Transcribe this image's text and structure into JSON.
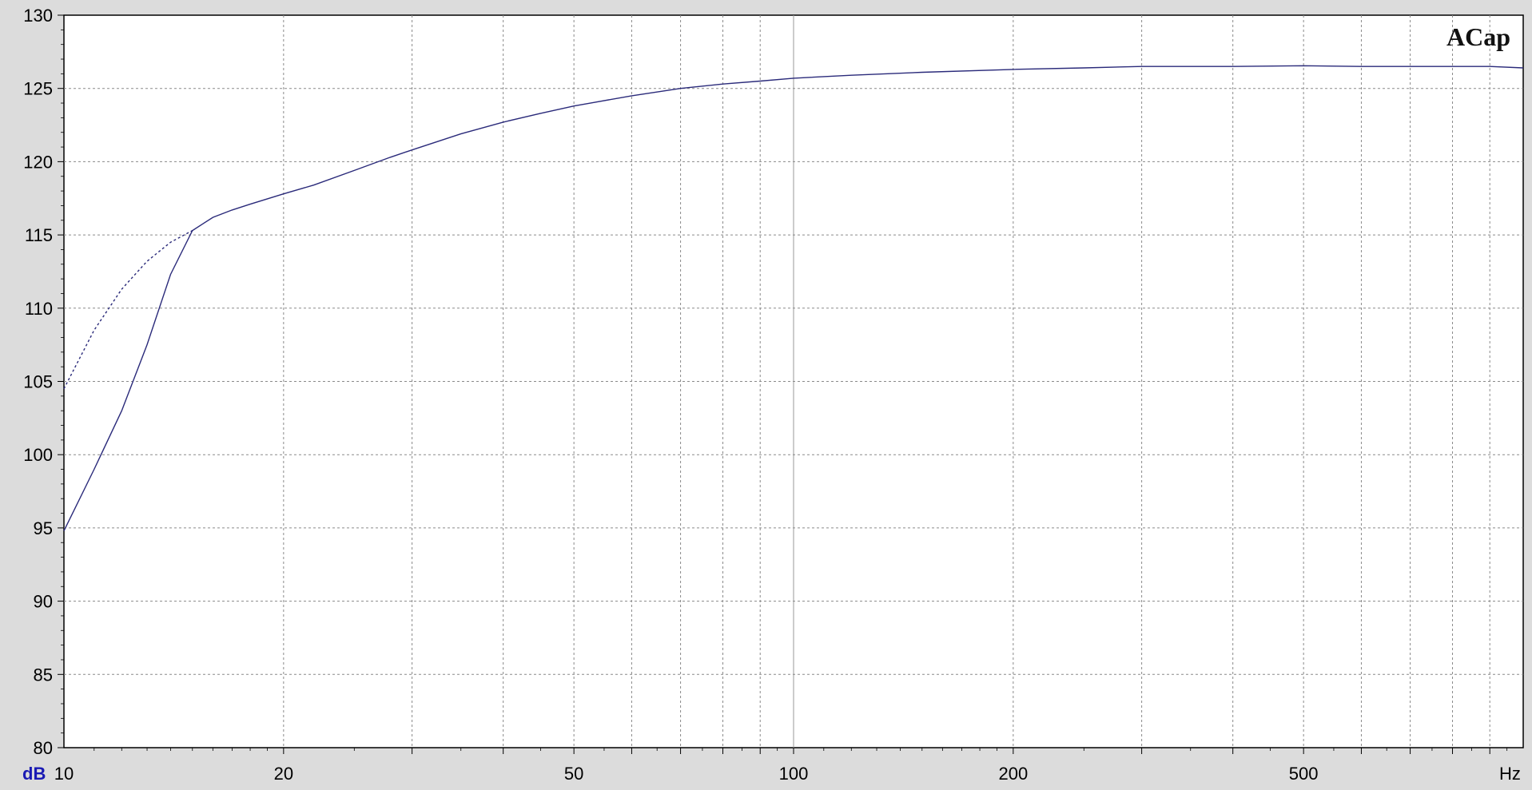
{
  "chart_data": {
    "type": "line",
    "brand": "ACap",
    "xlabel": "Hz",
    "ylabel": "dB",
    "xscale": "log",
    "xlim": [
      10,
      1000
    ],
    "ylim": [
      80,
      130
    ],
    "grid": true,
    "x_tick_labels": [
      "10",
      "20",
      "50",
      "100",
      "200",
      "500"
    ],
    "y_tick_labels": [
      "130",
      "125",
      "120",
      "115",
      "110",
      "105",
      "100",
      "95",
      "90",
      "85",
      "80"
    ],
    "series": [
      {
        "style": "solid",
        "color": "#2a2a7a",
        "x": [
          10,
          11,
          12,
          13,
          14,
          15,
          16,
          17,
          18,
          20,
          22,
          25,
          28,
          30,
          35,
          40,
          45,
          50,
          60,
          70,
          80,
          90,
          100,
          120,
          150,
          200,
          250,
          300,
          400,
          500,
          600,
          700,
          800,
          900,
          1000
        ],
        "y": [
          94.8,
          99.0,
          103.0,
          107.5,
          112.3,
          115.3,
          116.2,
          116.7,
          117.1,
          117.8,
          118.4,
          119.4,
          120.3,
          120.8,
          121.9,
          122.7,
          123.3,
          123.8,
          124.5,
          125.0,
          125.3,
          125.5,
          125.7,
          125.9,
          126.1,
          126.3,
          126.4,
          126.5,
          126.5,
          126.55,
          126.5,
          126.5,
          126.5,
          126.5,
          126.4
        ]
      },
      {
        "style": "dashed",
        "color": "#2a2a7a",
        "x": [
          10,
          11,
          12,
          13,
          14,
          15
        ],
        "y": [
          104.5,
          108.5,
          111.3,
          113.2,
          114.5,
          115.3
        ]
      }
    ]
  }
}
